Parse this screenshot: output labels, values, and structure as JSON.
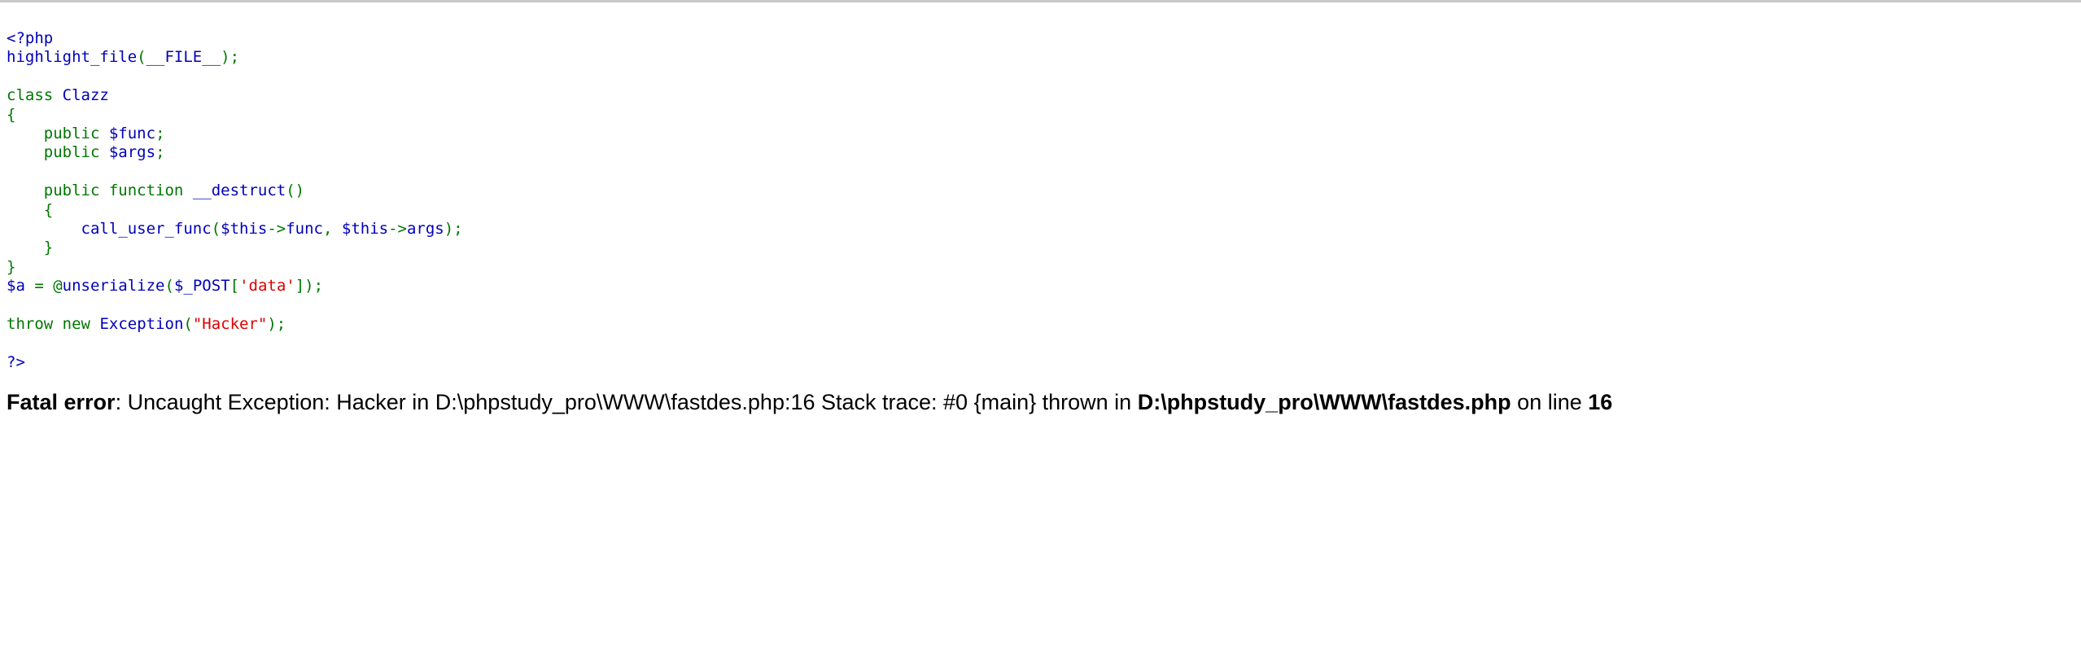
{
  "page": {
    "title": "fastdes.php",
    "background": "#ffffff",
    "top_rule_color": "#c8c8c8"
  },
  "syntax_colors": {
    "default": "#0000BB",
    "keyword": "#007700",
    "string": "#DD0000",
    "comment": "#FF8000",
    "html": "#000000"
  },
  "code": {
    "language": "php",
    "lines": [
      {
        "n": 1,
        "tokens": [
          {
            "t": "<?php",
            "c": "default"
          }
        ]
      },
      {
        "n": 2,
        "tokens": [
          {
            "t": "highlight_file",
            "c": "default"
          },
          {
            "t": "(",
            "c": "keyword"
          },
          {
            "t": "__FILE__",
            "c": "default"
          },
          {
            "t": ")",
            "c": "keyword"
          },
          {
            "t": ";",
            "c": "keyword"
          }
        ]
      },
      {
        "n": 3,
        "tokens": []
      },
      {
        "n": 4,
        "tokens": [
          {
            "t": "class",
            "c": "keyword"
          },
          {
            "t": " ",
            "c": "html"
          },
          {
            "t": "Clazz",
            "c": "default"
          }
        ]
      },
      {
        "n": 5,
        "tokens": [
          {
            "t": "{",
            "c": "keyword"
          }
        ]
      },
      {
        "n": 6,
        "tokens": [
          {
            "t": "    ",
            "c": "html"
          },
          {
            "t": "public",
            "c": "keyword"
          },
          {
            "t": " ",
            "c": "html"
          },
          {
            "t": "$func",
            "c": "default"
          },
          {
            "t": ";",
            "c": "keyword"
          }
        ]
      },
      {
        "n": 7,
        "tokens": [
          {
            "t": "    ",
            "c": "html"
          },
          {
            "t": "public",
            "c": "keyword"
          },
          {
            "t": " ",
            "c": "html"
          },
          {
            "t": "$args",
            "c": "default"
          },
          {
            "t": ";",
            "c": "keyword"
          }
        ]
      },
      {
        "n": 8,
        "tokens": []
      },
      {
        "n": 9,
        "tokens": [
          {
            "t": "    ",
            "c": "html"
          },
          {
            "t": "public",
            "c": "keyword"
          },
          {
            "t": " ",
            "c": "html"
          },
          {
            "t": "function",
            "c": "keyword"
          },
          {
            "t": " ",
            "c": "html"
          },
          {
            "t": "__destruct",
            "c": "default"
          },
          {
            "t": "()",
            "c": "keyword"
          }
        ]
      },
      {
        "n": 10,
        "tokens": [
          {
            "t": "    ",
            "c": "html"
          },
          {
            "t": "{",
            "c": "keyword"
          }
        ]
      },
      {
        "n": 11,
        "tokens": [
          {
            "t": "        ",
            "c": "html"
          },
          {
            "t": "call_user_func",
            "c": "default"
          },
          {
            "t": "(",
            "c": "keyword"
          },
          {
            "t": "$this",
            "c": "default"
          },
          {
            "t": "->",
            "c": "keyword"
          },
          {
            "t": "func",
            "c": "default"
          },
          {
            "t": ", ",
            "c": "keyword"
          },
          {
            "t": "$this",
            "c": "default"
          },
          {
            "t": "->",
            "c": "keyword"
          },
          {
            "t": "args",
            "c": "default"
          },
          {
            "t": ");",
            "c": "keyword"
          }
        ]
      },
      {
        "n": 12,
        "tokens": [
          {
            "t": "    ",
            "c": "html"
          },
          {
            "t": "}",
            "c": "keyword"
          }
        ]
      },
      {
        "n": 13,
        "tokens": [
          {
            "t": "}",
            "c": "keyword"
          }
        ]
      },
      {
        "n": 14,
        "tokens": [
          {
            "t": "$a",
            "c": "default"
          },
          {
            "t": " = ",
            "c": "keyword"
          },
          {
            "t": "@",
            "c": "keyword"
          },
          {
            "t": "unserialize",
            "c": "default"
          },
          {
            "t": "(",
            "c": "keyword"
          },
          {
            "t": "$_POST",
            "c": "default"
          },
          {
            "t": "[",
            "c": "keyword"
          },
          {
            "t": "'data'",
            "c": "string"
          },
          {
            "t": "]",
            "c": "keyword"
          },
          {
            "t": ");",
            "c": "keyword"
          }
        ]
      },
      {
        "n": 15,
        "tokens": []
      },
      {
        "n": 16,
        "tokens": [
          {
            "t": "throw",
            "c": "keyword"
          },
          {
            "t": " ",
            "c": "html"
          },
          {
            "t": "new",
            "c": "keyword"
          },
          {
            "t": " ",
            "c": "html"
          },
          {
            "t": "Exception",
            "c": "default"
          },
          {
            "t": "(",
            "c": "keyword"
          },
          {
            "t": "\"Hacker\"",
            "c": "string"
          },
          {
            "t": ");",
            "c": "keyword"
          }
        ]
      },
      {
        "n": 17,
        "tokens": []
      },
      {
        "n": 18,
        "tokens": [
          {
            "t": "?>",
            "c": "default"
          }
        ]
      }
    ]
  },
  "fatal_error": {
    "label": "Fatal error",
    "separator": ": ",
    "message": "Uncaught Exception: Hacker in D:\\phpstudy_pro\\WWW\\fastdes.php:16 Stack trace: #0 {main} thrown in ",
    "file": "D:\\phpstudy_pro\\WWW\\fastdes.php",
    "on_line_text": " on line ",
    "line_number": "16"
  }
}
